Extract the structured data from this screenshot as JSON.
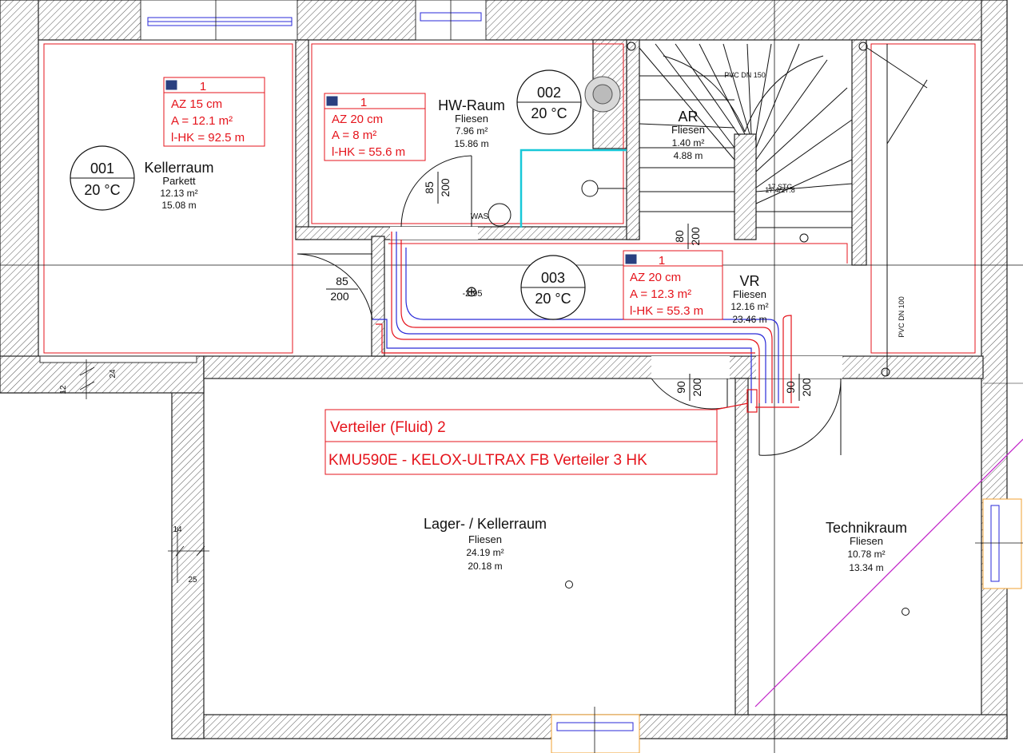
{
  "rooms": [
    {
      "id": "001",
      "temp": "20 °C",
      "name": "Kellerraum",
      "floor": "Parkett",
      "area": "12.13 m²",
      "perimeter": "15.08 m"
    },
    {
      "id": "002",
      "temp": "20 °C",
      "name": "HW-Raum",
      "floor": "Fliesen",
      "area": "7.96 m²",
      "perimeter": "15.86 m"
    },
    {
      "id": "003",
      "temp": "20 °C",
      "name": "VR",
      "floor": "Fliesen",
      "area": "12.16 m²",
      "perimeter": "23.46 m"
    },
    {
      "name": "AR",
      "floor": "Fliesen",
      "area": "1.40 m²",
      "perimeter": "4.88 m"
    },
    {
      "name": "Lager- / Kellerraum",
      "floor": "Fliesen",
      "area": "24.19 m²",
      "perimeter": "20.18 m"
    },
    {
      "name": "Technikraum",
      "floor": "Fliesen",
      "area": "10.78 m²",
      "perimeter": "13.34 m"
    }
  ],
  "circuits": [
    {
      "num": "1",
      "az": "AZ 15 cm",
      "a": "A = 12.1 m²",
      "l": "l-HK = 92.5 m"
    },
    {
      "num": "1",
      "az": "AZ 20 cm",
      "a": "A = 8 m²",
      "l": "l-HK = 55.6 m"
    },
    {
      "num": "1",
      "az": "AZ 20 cm",
      "a": "A = 12.3 m²",
      "l": "l-HK = 55.3 m"
    }
  ],
  "distributor": {
    "title": "Verteiler (Fluid) 2",
    "model": "KMU590E - KELOX-ULTRAX FB Verteiler 3 HK"
  },
  "doors": [
    {
      "w": "85",
      "h": "200"
    },
    {
      "w": "85",
      "h": "200"
    },
    {
      "w": "80",
      "h": "200"
    },
    {
      "w": "90",
      "h": "200"
    },
    {
      "w": "90",
      "h": "200"
    }
  ],
  "labels": {
    "level": "-2.95",
    "was": "WAS",
    "pvc150": "PVC DN 150",
    "pvc100": "PVC DN 100",
    "stairs": "17 STG",
    "stairs2": "17.4/27.8",
    "dim24": "24",
    "dim12": "12",
    "dim14": "14",
    "dim25": "25"
  },
  "colors": {
    "circuit": "#e5141c",
    "pipe_blue": "#2a2ad8",
    "cyan": "#18c8d8",
    "magenta": "#c020c8",
    "window_frame": "#f0a030"
  }
}
